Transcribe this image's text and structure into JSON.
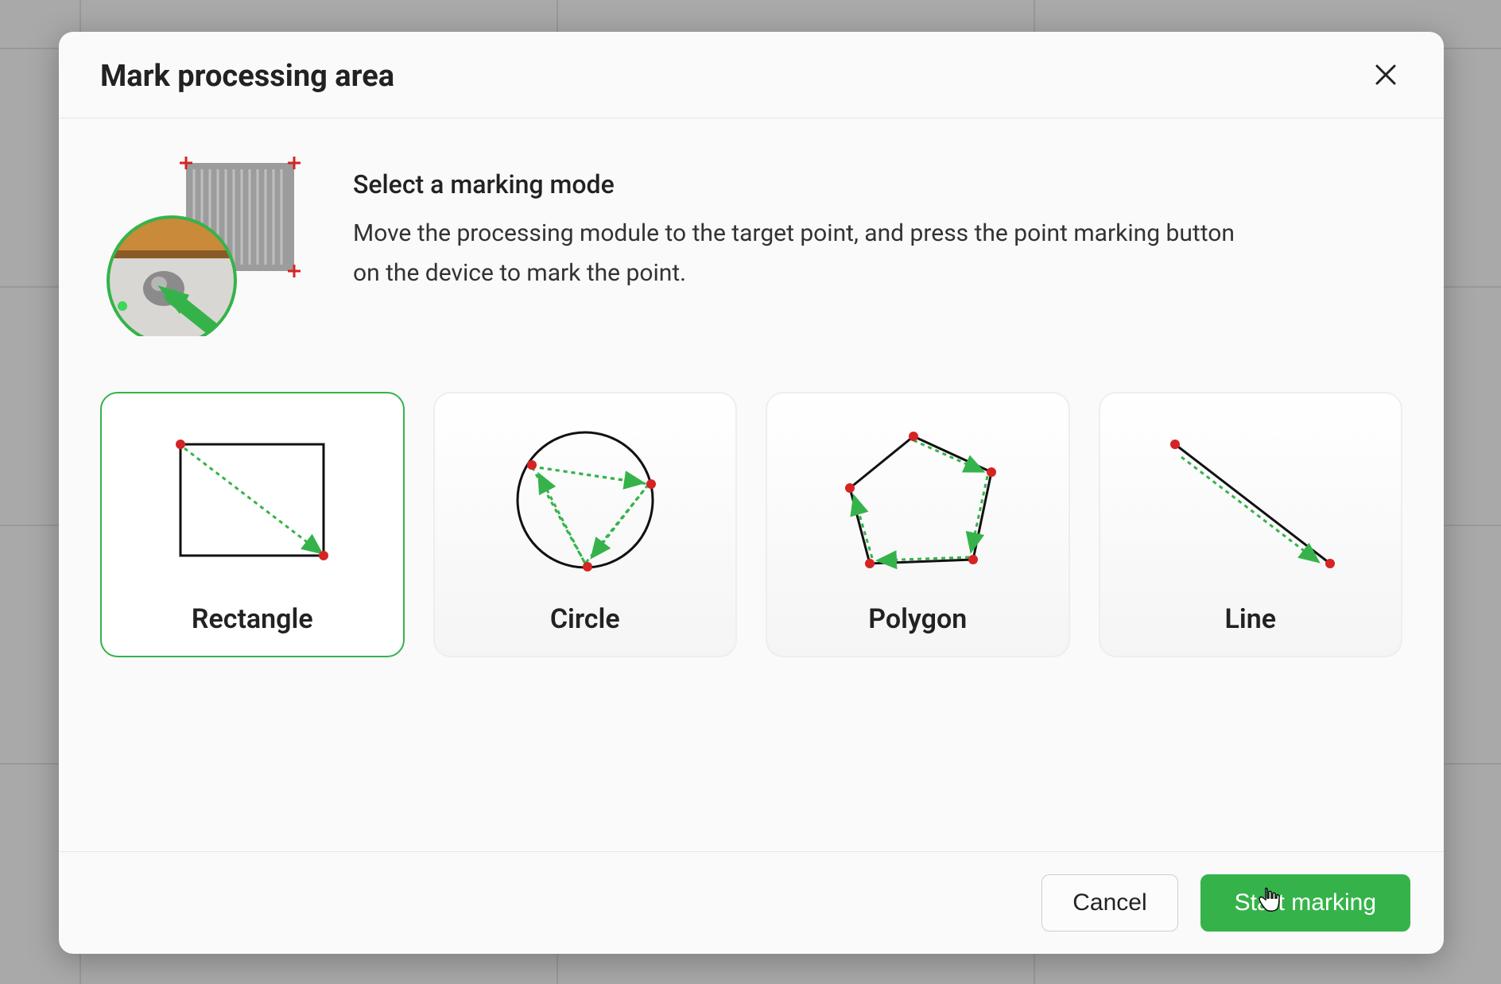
{
  "dialog": {
    "title": "Mark processing area",
    "intro_heading": "Select a marking mode",
    "intro_description": "Move the processing module to the target point, and press the point marking button on the device to mark the point.",
    "modes": [
      {
        "key": "rectangle",
        "label": "Rectangle",
        "selected": true
      },
      {
        "key": "circle",
        "label": "Circle",
        "selected": false
      },
      {
        "key": "polygon",
        "label": "Polygon",
        "selected": false
      },
      {
        "key": "line",
        "label": "Line",
        "selected": false
      }
    ],
    "buttons": {
      "cancel": "Cancel",
      "start": "Start marking"
    },
    "colors": {
      "accent": "#35b34a",
      "point": "#d62323"
    }
  }
}
